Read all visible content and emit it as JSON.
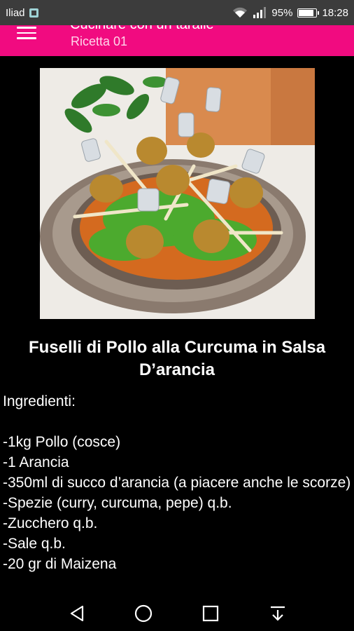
{
  "status_bar": {
    "carrier": "Iliad",
    "battery_percent": "95%",
    "battery_level": 0.95,
    "time": "18:28"
  },
  "app_bar": {
    "title": "Cucinare con un taralle",
    "subtitle": "Ricetta 01"
  },
  "recipe": {
    "title": "Fuselli di Pollo alla Curcuma in Salsa D’arancia",
    "ingredients_heading": "Ingredienti:",
    "ingredients": [
      "-1kg Pollo (cosce)",
      "-1 Arancia",
      "-350ml di succo d’arancia (a piacere anche le scorze)",
      "-Spezie (curry, curcuma, pepe) q.b.",
      "-Zucchero q.b.",
      "-Sale q.b.",
      "-20 gr di Maizena"
    ]
  },
  "colors": {
    "app_bar": "#f10b80",
    "status_bar": "#3c3c3c",
    "background": "#000000"
  },
  "icons": {
    "menu": "menu-icon",
    "wifi": "wifi-icon",
    "signal": "signal-icon",
    "battery": "battery-icon",
    "back": "back-icon",
    "home": "home-icon",
    "recents": "recents-icon",
    "notifications": "notification-pull-icon"
  }
}
